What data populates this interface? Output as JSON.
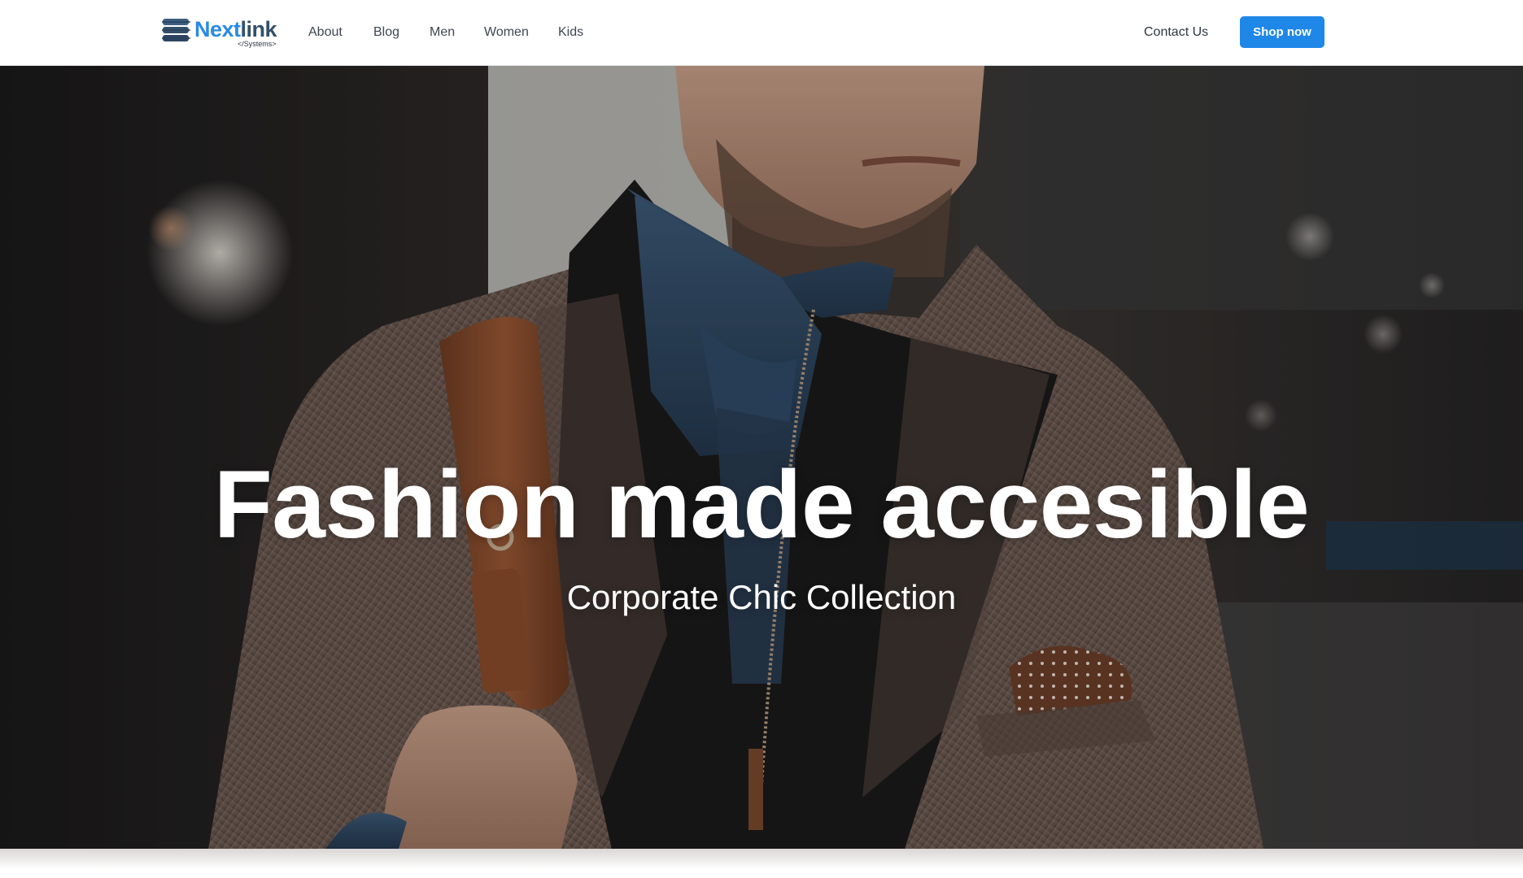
{
  "brand": {
    "name_part1": "Next",
    "name_part2": "link",
    "tagline": "</Systems>",
    "icon": "server-stack-icon",
    "color_primary": "#2a8ae4",
    "color_secondary": "#34506a"
  },
  "nav": {
    "items": [
      {
        "label": "About"
      },
      {
        "label": "Blog"
      },
      {
        "label": "Men"
      },
      {
        "label": "Women"
      },
      {
        "label": "Kids"
      }
    ],
    "contact_label": "Contact Us",
    "cta_label": "Shop now",
    "cta_color": "#1f87e8"
  },
  "hero": {
    "title": "Fashion made accesible",
    "subtitle": "Corporate Chic Collection"
  }
}
